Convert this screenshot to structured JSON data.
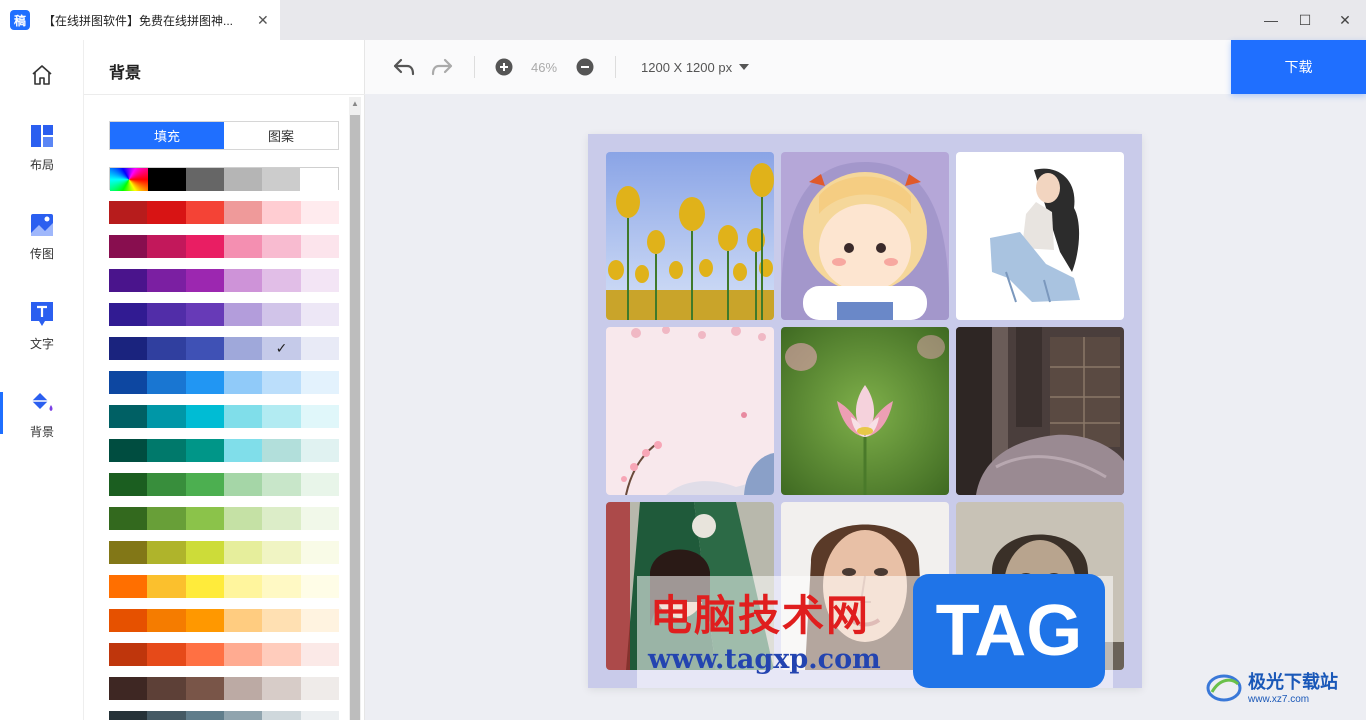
{
  "window": {
    "app_icon": "稿",
    "tab_title": "【在线拼图软件】免费在线拼图神...",
    "minimize": "—",
    "maximize": "☐",
    "close": "✕"
  },
  "nav": [
    {
      "label": "",
      "icon": "home-icon"
    },
    {
      "label": "布局",
      "icon": "layout-icon"
    },
    {
      "label": "传图",
      "icon": "upload-image-icon"
    },
    {
      "label": "文字",
      "icon": "text-icon"
    },
    {
      "label": "背景",
      "icon": "paint-bucket-icon",
      "active": true
    }
  ],
  "panel": {
    "title": "背景",
    "tabs": [
      "填充",
      "图案"
    ],
    "active_tab": 0
  },
  "swatches": [
    [
      "rainbow",
      "#000000",
      "#666666",
      "#b5b5b5",
      "#cccccc",
      "#ffffff"
    ],
    [
      "#b71c1c",
      "#d81414",
      "#f44336",
      "#ef9a9a",
      "#ffcdd2",
      "#ffebee"
    ],
    [
      "#880e4f",
      "#c2185b",
      "#e91e63",
      "#f48fb1",
      "#f8bbd0",
      "#fce4ec"
    ],
    [
      "#4a148c",
      "#7b1fa2",
      "#9c27b0",
      "#ce93d8",
      "#e1bee7",
      "#f3e5f5"
    ],
    [
      "#311b92",
      "#512da8",
      "#673ab7",
      "#b39ddb",
      "#d1c4e9",
      "#ede7f6"
    ],
    [
      "#1a237e",
      "#303f9f",
      "#3f51b5",
      "#9fa8da",
      "#c5cae9",
      "#e8eaf6"
    ],
    [
      "#0d47a1",
      "#1976d2",
      "#2196f3",
      "#90caf9",
      "#bbdefb",
      "#e3f2fd"
    ],
    [
      "#006064",
      "#0097a7",
      "#00bcd4",
      "#80deea",
      "#b2ebf2",
      "#e0f7fa"
    ],
    [
      "#004d40",
      "#00796b",
      "#009688",
      "#80deea",
      "#b2dfdb",
      "#e0f2f1"
    ],
    [
      "#1b5e20",
      "#388e3c",
      "#4caf50",
      "#a5d6a7",
      "#c8e6c9",
      "#e8f5e9"
    ],
    [
      "#33691e",
      "#689f38",
      "#8bc34a",
      "#c5e1a5",
      "#dcedc8",
      "#f1f8e9"
    ],
    [
      "#827717",
      "#afb42b",
      "#cddc39",
      "#e6ee9c",
      "#f0f4c3",
      "#f9fbe7"
    ],
    [
      "#ff6f00",
      "#fbc02d",
      "#ffeb3b",
      "#fff59d",
      "#fff9c4",
      "#fffde7"
    ],
    [
      "#e65100",
      "#f57c00",
      "#ff9800",
      "#ffcc80",
      "#ffe0b2",
      "#fff3e0"
    ],
    [
      "#bf360c",
      "#e64a19",
      "#ff7043",
      "#ffab91",
      "#ffccbc",
      "#fbe9e7"
    ],
    [
      "#3e2723",
      "#5d4037",
      "#795548",
      "#bcaaa4",
      "#d7ccc8",
      "#efebe9"
    ],
    [
      "#263238",
      "#455a64",
      "#607d8b",
      "#90a4ae",
      "#cfd8dc",
      "#eceff1"
    ]
  ],
  "selected_swatch": {
    "row": 5,
    "col": 4
  },
  "toolbar": {
    "zoom": "46%",
    "canvas_size": "1200 X 1200 px",
    "download": "下载"
  },
  "canvas": {
    "background": "#c9cbea",
    "images": [
      "yellow-tulips-photo",
      "cartoon-girl-illustration",
      "sitting-woman-sketch",
      "pink-floral-background",
      "pink-lotus-photo",
      "bedroom-photo",
      "woman-in-green-photo",
      "woman-portrait-photo",
      "old-woman-portrait-photo"
    ]
  },
  "watermark": {
    "cn_text": "电脑技术网",
    "url": "www.tagxp.com",
    "tag": "TAG",
    "logo_text": "极光下载站",
    "logo_url": "www.xz7.com"
  }
}
